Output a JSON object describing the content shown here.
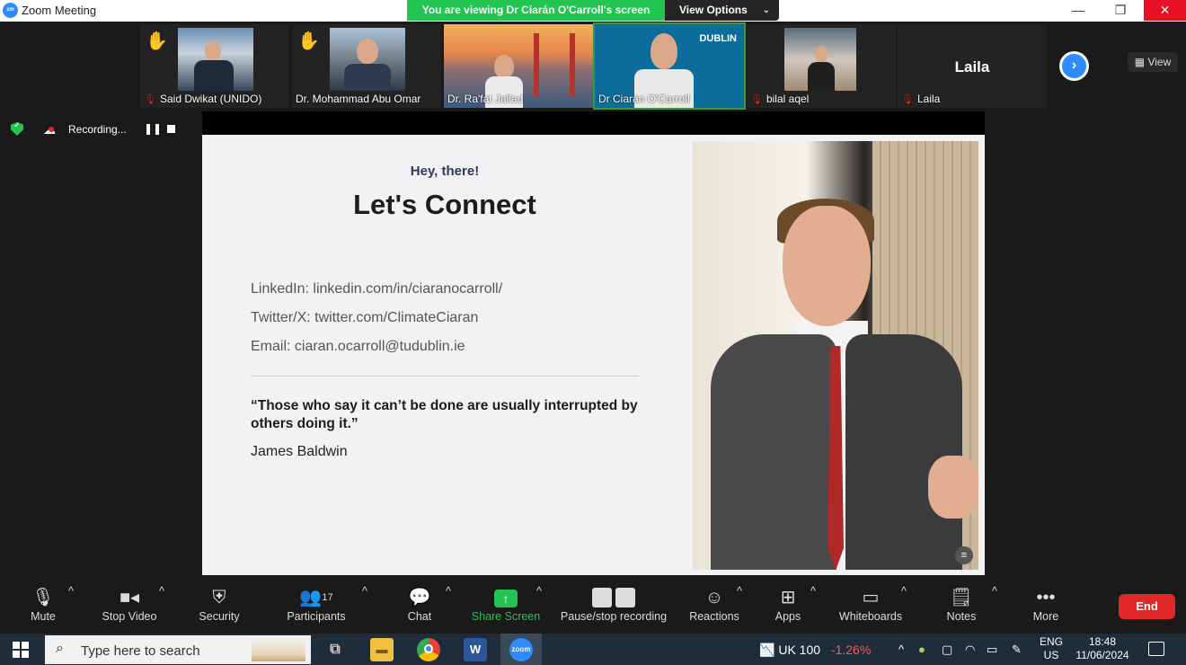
{
  "window": {
    "app_title": "Zoom Meeting",
    "share_banner": "You are viewing Dr Ciarán O'Carroll's screen",
    "view_options": "View Options",
    "view_button": "View"
  },
  "participants": [
    {
      "name": "Said Dwikat (UNIDO)",
      "hand_raised": true,
      "muted": true
    },
    {
      "name": "Dr. Mohammad Abu Omar",
      "hand_raised": true,
      "muted": false
    },
    {
      "name": "Dr. Ra'fat Jallad",
      "hand_raised": false,
      "muted": false
    },
    {
      "name": "Dr Ciarán O'Carroll",
      "hand_raised": false,
      "muted": false,
      "active": true
    },
    {
      "name": "bilal aqel",
      "hand_raised": false,
      "muted": true
    },
    {
      "name": "Laila",
      "hand_raised": false,
      "muted": true,
      "video_off": true,
      "display_name": "Laila"
    }
  ],
  "thumbnail_logo": "DUBLIN",
  "recording": {
    "label": "Recording..."
  },
  "slide": {
    "greeting": "Hey, there!",
    "headline": "Let's Connect",
    "linkedin": "LinkedIn: linkedin.com/in/ciaranocarroll/",
    "twitter": "Twitter/X: twitter.com/ClimateCiaran",
    "email": "Email: ciaran.ocarroll@tudublin.ie",
    "quote": "“Those who say it can’t be done are usually interrupted by others doing it.”",
    "author": "James Baldwin"
  },
  "toolbar": {
    "mute": "Mute",
    "stop_video": "Stop Video",
    "security": "Security",
    "participants": "Participants",
    "participants_count": "17",
    "chat": "Chat",
    "share_screen": "Share Screen",
    "pause_stop_recording": "Pause/stop recording",
    "reactions": "Reactions",
    "apps": "Apps",
    "whiteboards": "Whiteboards",
    "notes": "Notes",
    "more": "More",
    "end": "End"
  },
  "taskbar": {
    "search_placeholder": "Type here to search",
    "ticker_name": "UK 100",
    "ticker_change": "-1.26%",
    "lang_top": "ENG",
    "lang_bottom": "US",
    "time": "18:48",
    "date": "11/06/2024"
  },
  "colors": {
    "accent_green": "#23c552",
    "zoom_blue": "#2d8cff",
    "end_red": "#e02828",
    "close_red": "#e81123"
  }
}
